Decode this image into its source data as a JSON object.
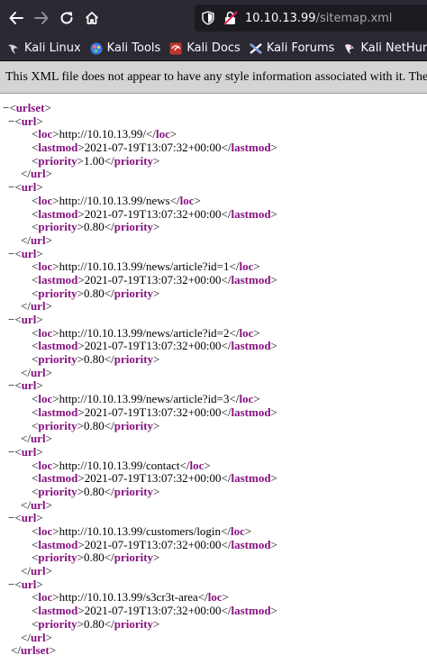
{
  "browser": {
    "url_host": "10.10.13.99",
    "url_path": "/sitemap.xml"
  },
  "bookmarks": [
    {
      "label": "Kali Linux",
      "icon": "kali-dragon-icon"
    },
    {
      "label": "Kali Tools",
      "icon": "kali-tools-icon"
    },
    {
      "label": "Kali Docs",
      "icon": "kali-docs-icon"
    },
    {
      "label": "Kali Forums",
      "icon": "kali-forums-icon"
    },
    {
      "label": "Kali NetHunter",
      "icon": "kali-nethunter-icon"
    }
  ],
  "infobar": {
    "message": "This XML file does not appear to have any style information associated with it. The document tree is shown below."
  },
  "xml": {
    "collapse_symbol": "−",
    "root_tag": "urlset",
    "url_tag": "url",
    "loc_tag": "loc",
    "lastmod_tag": "lastmod",
    "priority_tag": "priority",
    "urls": [
      {
        "loc": "http://10.10.13.99/",
        "lastmod": "2021-07-19T13:07:32+00:00",
        "priority": "1.00"
      },
      {
        "loc": "http://10.10.13.99/news",
        "lastmod": "2021-07-19T13:07:32+00:00",
        "priority": "0.80"
      },
      {
        "loc": "http://10.10.13.99/news/article?id=1",
        "lastmod": "2021-07-19T13:07:32+00:00",
        "priority": "0.80"
      },
      {
        "loc": "http://10.10.13.99/news/article?id=2",
        "lastmod": "2021-07-19T13:07:32+00:00",
        "priority": "0.80"
      },
      {
        "loc": "http://10.10.13.99/news/article?id=3",
        "lastmod": "2021-07-19T13:07:32+00:00",
        "priority": "0.80"
      },
      {
        "loc": "http://10.10.13.99/contact",
        "lastmod": "2021-07-19T13:07:32+00:00",
        "priority": "0.80"
      },
      {
        "loc": "http://10.10.13.99/customers/login",
        "lastmod": "2021-07-19T13:07:32+00:00",
        "priority": "0.80"
      },
      {
        "loc": "http://10.10.13.99/s3cr3t-area",
        "lastmod": "2021-07-19T13:07:32+00:00",
        "priority": "0.80"
      }
    ]
  }
}
